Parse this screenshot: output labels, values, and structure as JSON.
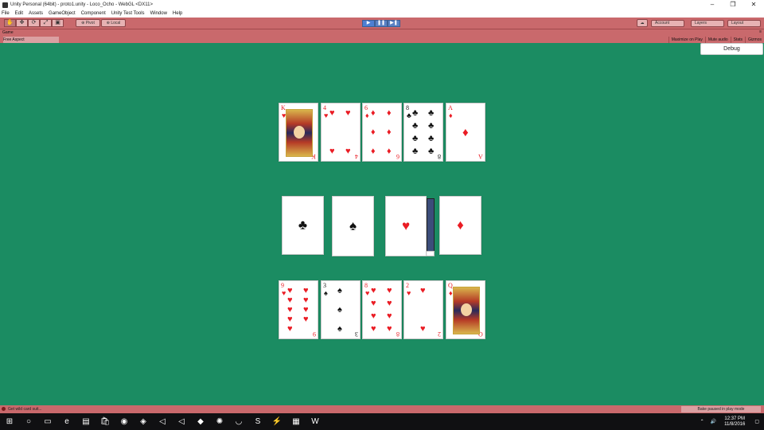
{
  "window": {
    "title": "Unity Personal (64bit) - proto1.unity - Loco_Ocho - WebGL <DX11>",
    "minimize": "–",
    "restore": "❐",
    "close": "✕"
  },
  "menu": [
    "File",
    "Edit",
    "Assets",
    "GameObject",
    "Component",
    "Unity Test Tools",
    "Window",
    "Help"
  ],
  "toolbar": {
    "tools": [
      "✋",
      "✥",
      "⟳",
      "⤢",
      "▣"
    ],
    "pivot_label": "Pivot",
    "local_label": "Local",
    "pivot_icon": "⊕",
    "local_icon": "⊕",
    "play_icon": "▶",
    "pause_icon": "❚❚",
    "step_icon": "▶❚",
    "cloud_icon": "☁",
    "account_label": "Account",
    "layers_label": "Layers",
    "layout_label": "Layout"
  },
  "game_tab": {
    "label": "Game",
    "menu": "≡"
  },
  "game_bar": {
    "aspect": "Free Aspect",
    "buttons": [
      "Maximize on Play",
      "Mute audio",
      "Stats",
      "Gizmos"
    ]
  },
  "debug_button": "Debug",
  "top_hand": [
    {
      "rank": "K",
      "suit": "♥",
      "color": "red",
      "face": true
    },
    {
      "rank": "4",
      "suit": "♥",
      "color": "red",
      "face": false
    },
    {
      "rank": "6",
      "suit": "♦",
      "color": "red",
      "face": false
    },
    {
      "rank": "8",
      "suit": "♣",
      "color": "black",
      "face": false
    },
    {
      "rank": "A",
      "suit": "♦",
      "color": "red",
      "face": false
    }
  ],
  "suit_choices": [
    {
      "suit": "♣",
      "color": "black"
    },
    {
      "suit": "♠",
      "color": "black"
    },
    {
      "suit": "♥",
      "color": "red"
    },
    {
      "suit": "♦",
      "color": "red"
    }
  ],
  "bottom_hand": [
    {
      "rank": "9",
      "suit": "♥",
      "color": "red",
      "face": false
    },
    {
      "rank": "3",
      "suit": "♠",
      "color": "black",
      "face": false
    },
    {
      "rank": "8",
      "suit": "♥",
      "color": "red",
      "face": false
    },
    {
      "rank": "2",
      "suit": "♥",
      "color": "red",
      "face": false
    },
    {
      "rank": "Q",
      "suit": "♦",
      "color": "red",
      "face": true
    }
  ],
  "status": {
    "message": "Get wild card suit...",
    "note": "Bake paused in play mode"
  },
  "taskbar": {
    "icons": [
      "⊞",
      "○",
      "▭",
      "e",
      "▤",
      "🛍",
      "◉",
      "◈",
      "◁",
      "◁",
      "◆",
      "✺",
      "◡",
      "S",
      "⚡",
      "▦",
      "W"
    ],
    "time": "12:37 PM",
    "date": "11/8/2016"
  },
  "colors": {
    "table": "#1b8c62",
    "toolbar": "#c9696c",
    "red_suit": "#ea1c24"
  }
}
